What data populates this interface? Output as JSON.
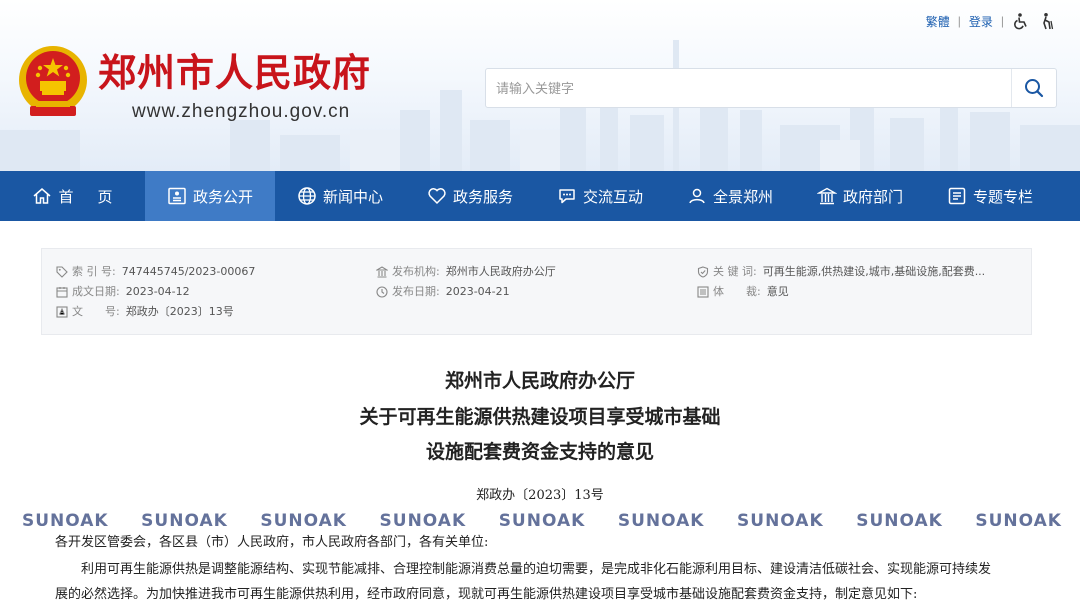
{
  "header": {
    "site_title": "郑州市人民政府",
    "site_url": "www.zhengzhou.gov.cn",
    "top_links": {
      "traditional": "繁體",
      "login": "登录"
    },
    "search": {
      "placeholder": "请输入关键字"
    },
    "icons": {
      "emblem": "national-emblem",
      "search": "search-icon",
      "accessibility": "wheelchair-icon",
      "elderly": "elderly-icon"
    },
    "colors": {
      "title_red": "#c8141b",
      "nav_blue": "#1a57a3",
      "nav_active": "#3f7bc6"
    }
  },
  "nav": {
    "items": [
      {
        "label": "首页",
        "icon": "home-icon"
      },
      {
        "label": "政务公开",
        "icon": "id-card-icon"
      },
      {
        "label": "新闻中心",
        "icon": "globe-icon"
      },
      {
        "label": "政务服务",
        "icon": "heart-icon"
      },
      {
        "label": "交流互动",
        "icon": "chat-icon"
      },
      {
        "label": "全景郑州",
        "icon": "user-icon"
      },
      {
        "label": "政府部门",
        "icon": "building-icon"
      },
      {
        "label": "专题专栏",
        "icon": "list-icon"
      }
    ],
    "active_index": 1
  },
  "meta": {
    "index_label": "索 引 号:",
    "index_value": "747445745/2023-00067",
    "created_label": "成文日期:",
    "created_value": "2023-04-12",
    "docno_label": "文　　号:",
    "docno_value": "郑政办〔2023〕13号",
    "publisher_label": "发布机构:",
    "publisher_value": "郑州市人民政府办公厅",
    "published_label": "发布日期:",
    "published_value": "2023-04-21",
    "keywords_label": "关 键 词:",
    "keywords_value": "可再生能源,供热建设,城市,基础设施,配套费...",
    "genre_label": "体　　裁:",
    "genre_value": "意见"
  },
  "document": {
    "title_line1": "郑州市人民政府办公厅",
    "title_line2": "关于可再生能源供热建设项目享受城市基础",
    "title_line3": "设施配套费资金支持的意见",
    "doc_number": "郑政办〔2023〕13号",
    "addressee": "各开发区管委会，各区县（市）人民政府，市人民政府各部门，各有关单位:",
    "paragraph1_line1": "利用可再生能源供热是调整能源结构、实现节能减排、合理控制能源消费总量的迫切需要，是完成非化石能源利用目标、建设清洁低碳社会、实现能源可持续发",
    "paragraph1_line2": "展的必然选择。为加快推进我市可再生能源供热利用，经市政府同意，现就可再生能源供热建设项目享受城市基础设施配套费资金支持，制定意见如下:"
  },
  "watermark": {
    "text": "SUNOAK",
    "count": 9
  }
}
